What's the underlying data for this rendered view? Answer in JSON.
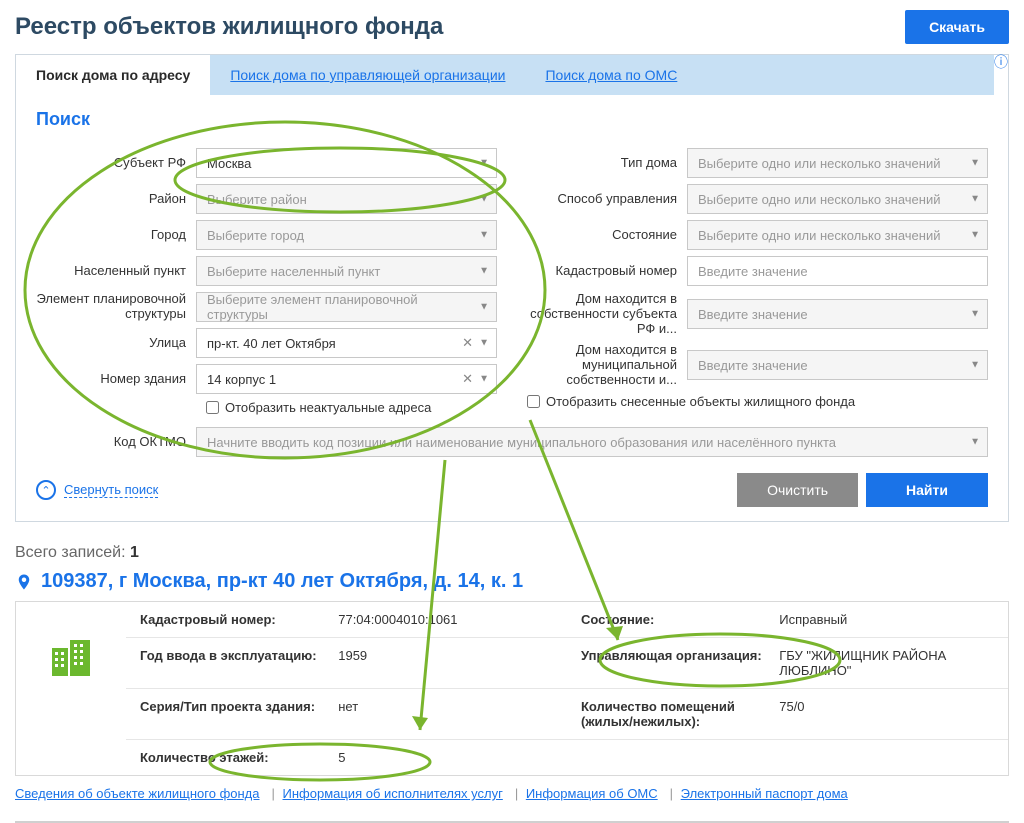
{
  "header": {
    "title": "Реестр объектов жилищного фонда",
    "download": "Скачать"
  },
  "tabs": {
    "by_address": "Поиск дома по адресу",
    "by_org": "Поиск дома по управляющей организации",
    "by_oms": "Поиск дома по ОМС"
  },
  "search": {
    "heading": "Поиск",
    "left": {
      "subject_label": "Субъект РФ",
      "subject_value": "Москва",
      "district_label": "Район",
      "district_placeholder": "Выберите район",
      "city_label": "Город",
      "city_placeholder": "Выберите город",
      "locality_label": "Населенный пункт",
      "locality_placeholder": "Выберите населенный пункт",
      "planning_label": "Элемент планировочной структуры",
      "planning_placeholder": "Выберите элемент планировочной структуры",
      "street_label": "Улица",
      "street_value": "пр-кт. 40 лет Октября",
      "building_label": "Номер здания",
      "building_value": "14 корпус 1",
      "outdated_check": "Отобразить неактуальные адреса",
      "oktmo_label": "Код ОКТМО",
      "oktmo_placeholder": "Начните вводить код позиции или наименование муниципального образования или населённого пункта"
    },
    "right": {
      "house_type_label": "Тип дома",
      "house_type_placeholder": "Выберите одно или несколько значений",
      "manage_label": "Способ управления",
      "manage_placeholder": "Выберите одно или несколько значений",
      "state_label": "Состояние",
      "state_placeholder": "Выберите одно или несколько значений",
      "cadastral_label": "Кадастровый номер",
      "cadastral_placeholder": "Введите значение",
      "subject_own_label": "Дом находится в собственности субъекта РФ и...",
      "subject_own_placeholder": "Введите значение",
      "municipal_own_label": "Дом находится в муниципальной собственности и...",
      "municipal_own_placeholder": "Введите значение",
      "demolished_check": "Отобразить снесенные объекты жилищного фонда"
    },
    "collapse": "Свернуть поиск",
    "clear": "Очистить",
    "find": "Найти"
  },
  "results": {
    "total_label": "Всего записей: ",
    "total_count": "1",
    "address": "109387, г Москва, пр-кт 40 лет Октября, д. 14, к. 1",
    "row1": {
      "cadastral_label": "Кадастровый номер:",
      "cadastral_value": "77:04:0004010:1061",
      "state_label": "Состояние:",
      "state_value": "Исправный"
    },
    "row2": {
      "year_label": "Год ввода в эксплуатацию:",
      "year_value": "1959",
      "manager_label": "Управляющая организация:",
      "manager_value": "ГБУ \"ЖИЛИЩНИК РАЙОНА ЛЮБЛИНО\""
    },
    "row3": {
      "series_label": "Серия/Тип проекта здания:",
      "series_value": "нет",
      "rooms_label": "Количество помещений (жилых/нежилых):",
      "rooms_value": "75/0"
    },
    "row4": {
      "floors_label": "Количество этажей:",
      "floors_value": "5"
    },
    "links": {
      "info_object": "Сведения об объекте жилищного фонда",
      "info_exec": "Информация об исполнителях услуг",
      "info_oms": "Информация об ОМС",
      "passport": "Электронный паспорт дома"
    }
  }
}
